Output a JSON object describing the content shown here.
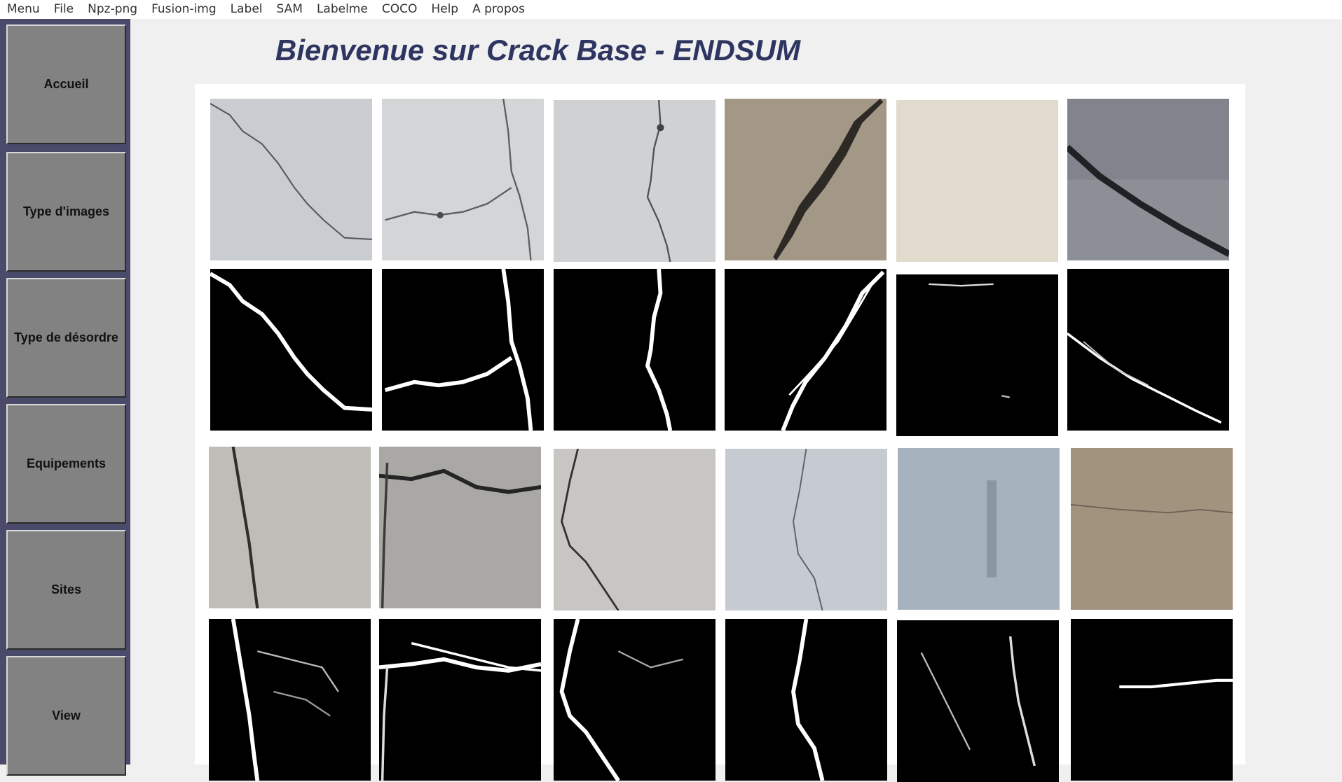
{
  "menu": {
    "items": [
      "Menu",
      "File",
      "Npz-png",
      "Fusion-img",
      "Label",
      "SAM",
      "Labelme",
      "COCO",
      "Help",
      "A propos"
    ]
  },
  "sidebar": {
    "buttons": [
      "Accueil",
      "Type d'images",
      "Type de désordre",
      "Equipements",
      "Sites",
      "View"
    ]
  },
  "main": {
    "title": "Bienvenue sur Crack Base - ENDSUM"
  },
  "colors": {
    "sidebar_bg": "#4a4a6a",
    "button_bg": "#828282",
    "title_color": "#2e3560",
    "panel_bg": "#ffffff"
  }
}
